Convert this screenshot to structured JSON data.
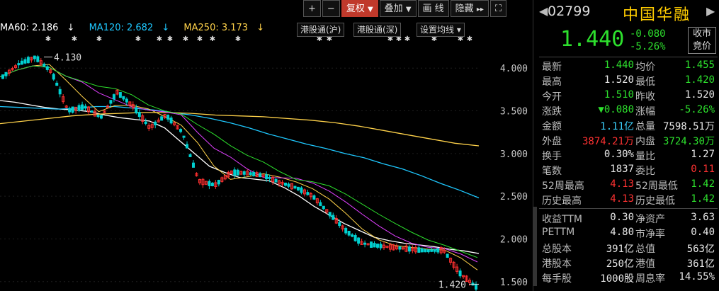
{
  "toolbar": {
    "plus": "+",
    "minus": "−",
    "fuquan": "复权",
    "fuquan_arrow": "▼",
    "diejia": "叠加",
    "diejia_arrow": "▼",
    "huaxian": "画 线",
    "yincang": "隐藏",
    "yincang_arrow": "▸▸",
    "fullscreen": "⛶"
  },
  "ma_legend": {
    "ma60": "MA60: 2.186",
    "ma60_arrow": "↓",
    "ma120": "MA120: 2.682",
    "ma120_arrow": "↓",
    "ma250": "MA250: 3.173",
    "ma250_arrow": "↓"
  },
  "chart_buttons": {
    "hk_hu": "港股通(沪)",
    "hk_shen": "港股通(深)",
    "ma_settings": "设置均线",
    "ma_settings_arrow": "▾"
  },
  "axis": {
    "ticks": [
      "4.000",
      "3.500",
      "3.000",
      "2.500",
      "2.000",
      "1.500"
    ],
    "high_label": "4.130",
    "low_label": "1.420"
  },
  "colors": {
    "up": "#ff3030",
    "down": "#00d0d0",
    "ma60": "#ffffff",
    "ma120": "#1ec8ff",
    "ma250": "#ffd24a",
    "green": "#2de02d",
    "red": "#ff3232",
    "yellow": "#ffcc00"
  },
  "stock": {
    "code": "02799",
    "name": "中国华融",
    "price": "1.440",
    "change": "-0.080",
    "change_pct": "-5.26%",
    "market_btn": "收市竞价"
  },
  "quotes": [
    {
      "l1": "最新",
      "v1": "1.440",
      "c1": "green",
      "l2": "均价",
      "v2": "1.455",
      "c2": "green"
    },
    {
      "l1": "最高",
      "v1": "1.520",
      "c1": "white",
      "l2": "最低",
      "v2": "1.420",
      "c2": "green"
    },
    {
      "l1": "今开",
      "v1": "1.510",
      "c1": "green",
      "l2": "昨收",
      "v2": "1.520",
      "c2": "white"
    },
    {
      "l1": "涨跌",
      "v1": "▼0.080",
      "c1": "green",
      "l2": "涨幅",
      "v2": "-5.26%",
      "c2": "green"
    },
    {
      "l1": "金额",
      "v1": "1.11亿",
      "c1": "cyan",
      "l2": "总量",
      "v2": "7598.51万",
      "c2": "white"
    },
    {
      "l1": "外盘",
      "v1": "3874.21万",
      "c1": "red",
      "l2": "内盘",
      "v2": "3724.30万",
      "c2": "green"
    },
    {
      "l1": "换手",
      "v1": "0.30%",
      "c1": "white",
      "l2": "量比",
      "v2": "1.27",
      "c2": "white"
    },
    {
      "l1": "笔数",
      "v1": "1837",
      "c1": "white",
      "l2": "委比",
      "v2": "0.11",
      "c2": "red"
    },
    {
      "l1": "52周最高",
      "v1": "4.13",
      "c1": "red",
      "l2": "52周最低",
      "v2": "1.42",
      "c2": "green"
    },
    {
      "l1": "历史最高",
      "v1": "4.13",
      "c1": "red",
      "l2": "历史最低",
      "v2": "1.42",
      "c2": "green"
    }
  ],
  "fundamentals": [
    {
      "l1": "收益TTM",
      "v1": "0.30",
      "l2": "净资产",
      "v2": "3.63"
    },
    {
      "l1": "PETTM",
      "v1": "4.80",
      "l2": "市净率",
      "v2": "0.40"
    },
    {
      "l1": "总股本",
      "v1": "391亿",
      "l2": "总值",
      "v2": "563亿"
    },
    {
      "l1": "港股本",
      "v1": "250亿",
      "l2": "港值",
      "v2": "361亿"
    },
    {
      "l1": "每手股",
      "v1": "1000股",
      "l2": "周息率",
      "v2": "14.55%"
    }
  ],
  "chart_data": {
    "type": "line",
    "ylim": [
      1.44,
      4.3
    ],
    "y_ticks": [
      4.0,
      3.5,
      3.0,
      2.5,
      2.0,
      1.5
    ],
    "series": [
      {
        "name": "MA60",
        "color": "#ffffff",
        "values": [
          3.62,
          3.6,
          3.57,
          3.54,
          3.52,
          3.51,
          3.49,
          3.45,
          3.42,
          3.4,
          3.38,
          3.3,
          3.15,
          3.0,
          2.85,
          2.78,
          2.72,
          2.7,
          2.68,
          2.6,
          2.5,
          2.38,
          2.28,
          2.18,
          2.1,
          2.02,
          1.98,
          1.95,
          1.93,
          1.91,
          1.88,
          1.86,
          1.83
        ]
      },
      {
        "name": "MA120",
        "color": "#1ec8ff",
        "values": [
          3.55,
          3.54,
          3.53,
          3.52,
          3.53,
          3.55,
          3.55,
          3.53,
          3.51,
          3.48,
          3.45,
          3.41,
          3.36,
          3.3,
          3.23,
          3.17,
          3.11,
          3.06,
          3.0,
          2.95,
          2.88,
          2.82,
          2.74,
          2.65,
          2.57,
          2.48
        ]
      },
      {
        "name": "MA250",
        "color": "#ffd24a",
        "values": [
          3.35,
          3.38,
          3.41,
          3.44,
          3.46,
          3.47,
          3.48,
          3.48,
          3.47,
          3.45,
          3.44,
          3.43,
          3.41,
          3.39,
          3.36,
          3.32,
          3.27,
          3.22,
          3.17,
          3.12,
          3.09
        ]
      }
    ],
    "price_path": [
      3.9,
      4.05,
      4.13,
      3.95,
      3.5,
      3.55,
      3.42,
      3.72,
      3.55,
      3.3,
      3.45,
      3.25,
      2.68,
      2.63,
      2.78,
      2.77,
      2.74,
      2.66,
      2.6,
      2.5,
      2.3,
      2.1,
      1.95,
      1.92,
      1.9,
      1.88,
      1.86,
      1.87,
      1.6,
      1.44
    ],
    "high": 4.13,
    "low": 1.42
  }
}
